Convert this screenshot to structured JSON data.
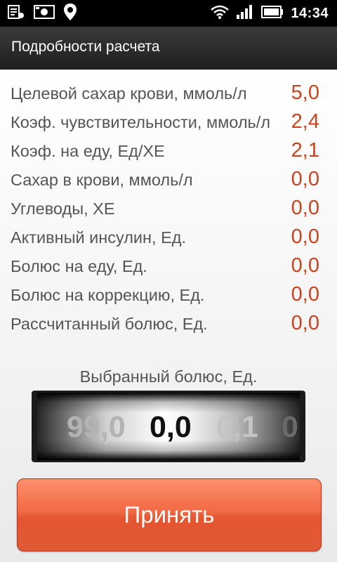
{
  "status_bar": {
    "time": "14:34",
    "icons": [
      "usb-debug-icon",
      "screenshot-icon",
      "location-pin-icon",
      "wifi-icon",
      "signal-icon",
      "battery-icon"
    ]
  },
  "header": {
    "title": "Подробности расчета"
  },
  "details": [
    {
      "label": "Целевой сахар крови, ммоль/л",
      "value": "5,0"
    },
    {
      "label": "Коэф. чувствительности, ммоль/л",
      "value": "2,4"
    },
    {
      "label": "Коэф. на еду, Ед/ХЕ",
      "value": "2,1"
    },
    {
      "label": "Сахар в крови, ммоль/л",
      "value": "0,0"
    },
    {
      "label": "Углеводы, ХЕ",
      "value": "0,0"
    },
    {
      "label": "Активный инсулин, Ед.",
      "value": "0,0"
    },
    {
      "label": "Болюс на еду, Ед.",
      "value": "0,0"
    },
    {
      "label": "Болюс на коррекцию, Ед.",
      "value": "0,0"
    },
    {
      "label": "Рассчитанный болюс, Ед.",
      "value": "0,0"
    }
  ],
  "selected_bolus": {
    "label": "Выбранный болюс, Ед.",
    "wheel": {
      "previous": "99,0",
      "current": "0,0",
      "next": "0,1",
      "next2": "0"
    }
  },
  "accept_button": {
    "label": "Принять"
  },
  "colors": {
    "value_accent": "#c8441e",
    "button": "#ee6440",
    "header": "#2b2b2b"
  }
}
